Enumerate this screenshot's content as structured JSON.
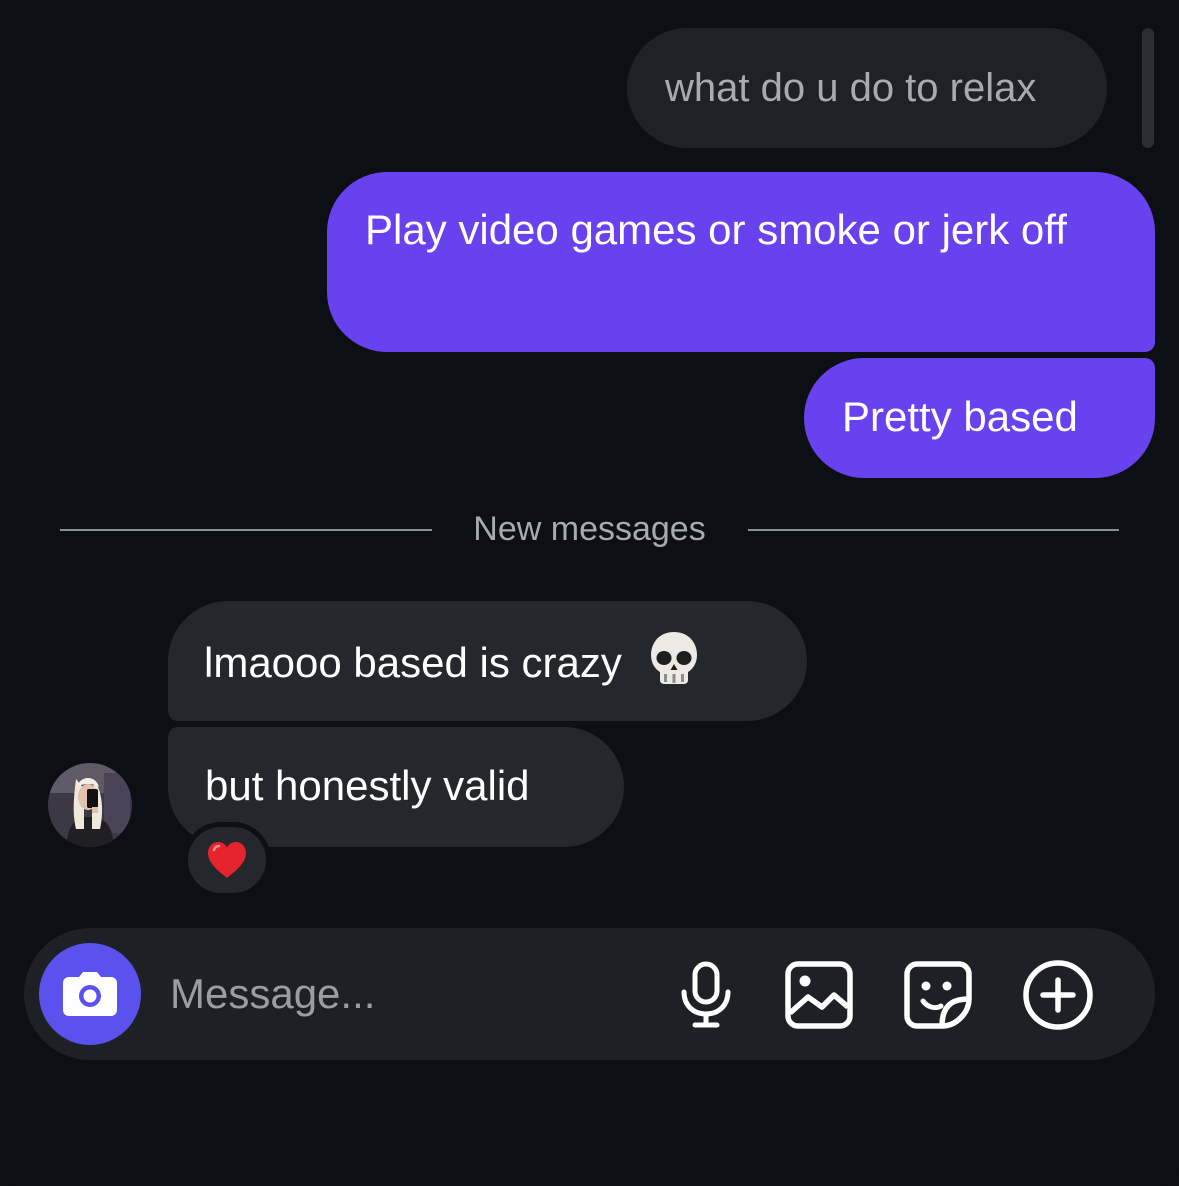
{
  "thread": {
    "quoted_message": "what do u do to relax",
    "sent_messages": [
      "Play video games or smoke or jerk off",
      "Pretty based"
    ],
    "new_messages_divider": "New messages",
    "received_messages": [
      {
        "text": "lmaooo based is crazy",
        "emoji": "skull"
      },
      {
        "text": "but honestly valid"
      }
    ],
    "reaction": "heart"
  },
  "composer": {
    "placeholder": "Message...",
    "icons": [
      "camera-icon",
      "microphone-icon",
      "image-icon",
      "sticker-icon",
      "add-icon"
    ]
  },
  "colors": {
    "background": "#0c0f14",
    "sent_bubble": "#6842ee",
    "received_bubble": "#24272c",
    "camera_button": "#5b51ec"
  }
}
